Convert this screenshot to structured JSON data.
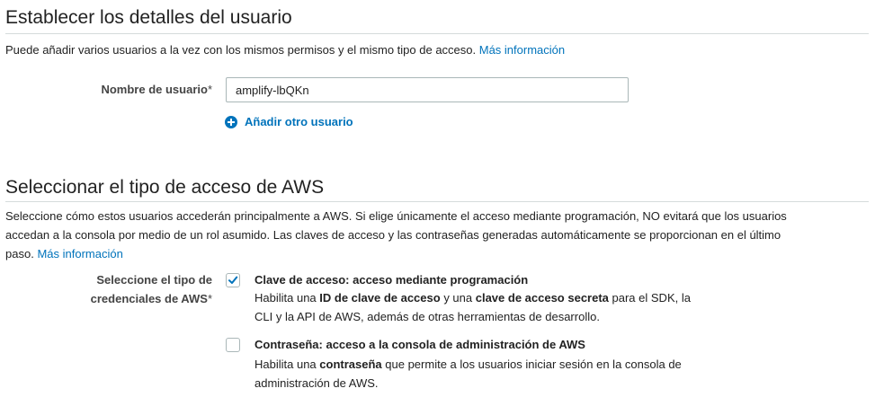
{
  "details": {
    "title": "Establecer los detalles del usuario",
    "description": "Puede añadir varios usuarios a la vez con los mismos permisos y el mismo tipo de acceso.",
    "more_info_link": "Más información",
    "username_label": "Nombre de usuario",
    "required_marker": "*",
    "username_value": "amplify-lbQKn",
    "add_user_label": "Añadir otro usuario"
  },
  "access": {
    "title": "Seleccionar el tipo de acceso de AWS",
    "description_line1": "Seleccione cómo estos usuarios accederán principalmente a AWS. Si elige únicamente el acceso mediante programación, NO evitará que los usuarios",
    "description_line2": "accedan a la consola por medio de un rol asumido. Las claves de acceso y las contraseñas generadas automáticamente se proporcionan en el último",
    "description_line3": "paso.",
    "more_info_link": "Más información",
    "credential_label_line1": "Seleccione el tipo de",
    "credential_label_line2": "credenciales de AWS",
    "required_marker": "*",
    "options": [
      {
        "title": "Clave de acceso: acceso mediante programación",
        "checked": true,
        "desc_prefix": "Habilita una ",
        "desc_bold1": "ID de clave de acceso",
        "desc_mid": " y una ",
        "desc_bold2": "clave de acceso secreta",
        "desc_suffix": " para el SDK, la",
        "desc_line2": "CLI y la API de AWS, además de otras herramientas de desarrollo."
      },
      {
        "title": "Contraseña: acceso a la consola de administración de AWS",
        "checked": false,
        "desc_prefix": "Habilita una ",
        "desc_bold1": "contraseña",
        "desc_suffix": " que permite a los usuarios iniciar sesión en la consola de",
        "desc_line2": "administración de AWS."
      }
    ]
  },
  "colors": {
    "link": "#0073bb",
    "divider": "#d5dbdb",
    "checkbox_check": "#0073bb"
  },
  "icons": {
    "add_user": "plus-circle-icon",
    "checked": "checkmark-icon"
  }
}
